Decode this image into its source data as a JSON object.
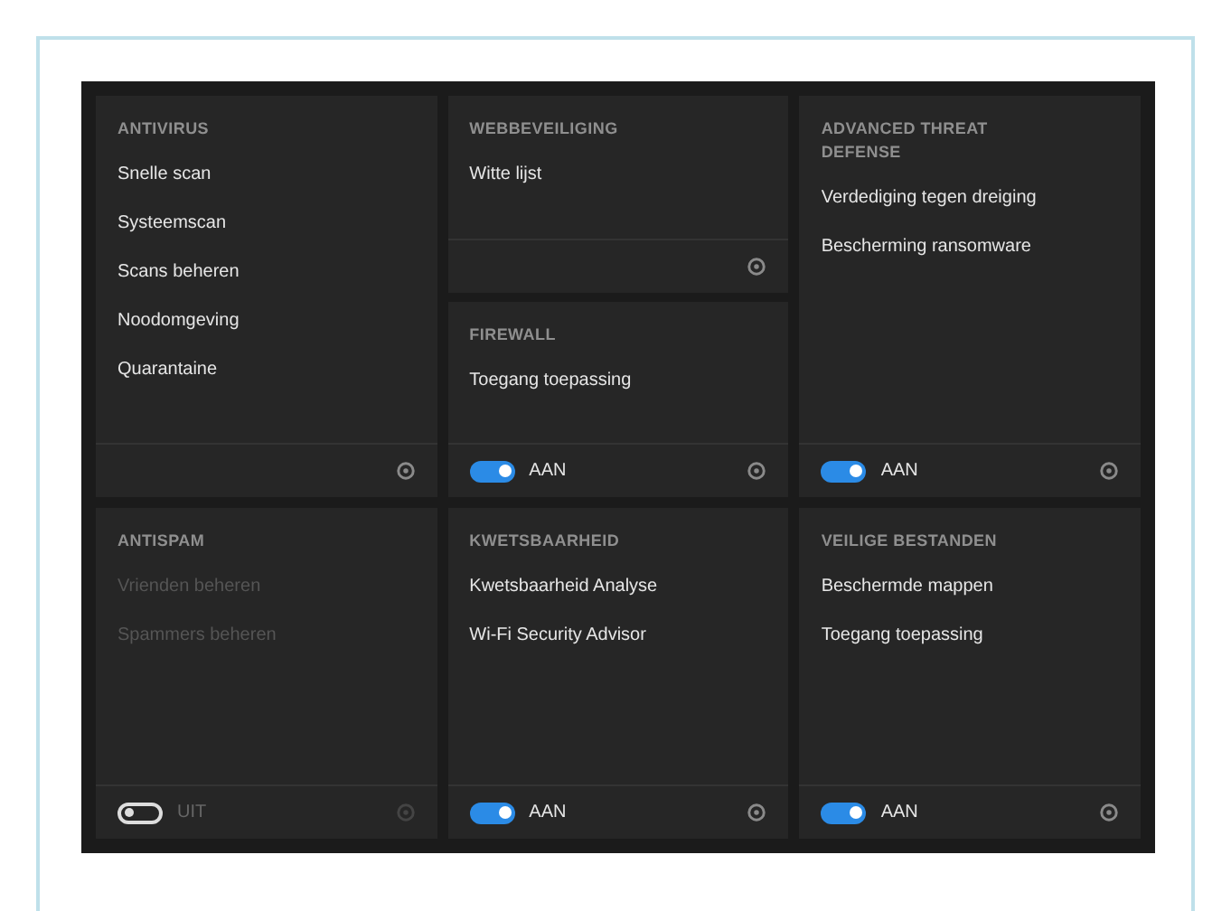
{
  "rows": [
    {
      "cells": [
        {
          "cards": [
            {
              "title": "ANTIVIRUS",
              "enabled": true,
              "items": [
                "Snelle scan",
                "Systeemscan",
                "Scans beheren",
                "Noodomgeving",
                "Quarantaine"
              ]
            }
          ]
        },
        {
          "cards": [
            {
              "title": "WEBBEVEILIGING",
              "enabled": true,
              "items": [
                "Witte lijst"
              ]
            },
            {
              "title": "FIREWALL",
              "enabled": true,
              "items": [
                "Toegang toepassing"
              ],
              "toggle": {
                "on": true,
                "label": "AAN"
              }
            }
          ]
        },
        {
          "cards": [
            {
              "title": "ADVANCED THREAT DEFENSE",
              "enabled": true,
              "items": [
                "Verdediging tegen dreiging",
                "Bescherming ransomware"
              ],
              "toggle": {
                "on": true,
                "label": "AAN"
              }
            }
          ]
        }
      ]
    },
    {
      "cells": [
        {
          "cards": [
            {
              "title": "ANTISPAM",
              "enabled": false,
              "items": [
                "Vrienden beheren",
                "Spammers beheren"
              ],
              "toggle": {
                "on": false,
                "label": "UIT"
              }
            }
          ]
        },
        {
          "cards": [
            {
              "title": "KWETSBAARHEID",
              "enabled": true,
              "items": [
                "Kwetsbaarheid Analyse",
                "Wi-Fi Security Advisor"
              ],
              "toggle": {
                "on": true,
                "label": "AAN"
              }
            }
          ]
        },
        {
          "cards": [
            {
              "title": "VEILIGE BESTANDEN",
              "enabled": true,
              "items": [
                "Beschermde mappen",
                "Toegang toepassing"
              ],
              "toggle": {
                "on": true,
                "label": "AAN"
              }
            }
          ]
        }
      ]
    }
  ]
}
